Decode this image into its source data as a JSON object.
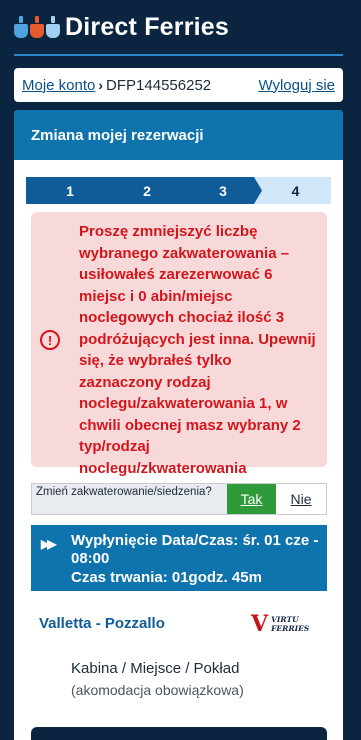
{
  "brand": {
    "name": "Direct Ferries",
    "icons": [
      "ferry-icon-blue",
      "ferry-icon-red",
      "ferry-icon-light-blue"
    ],
    "colors": [
      "#4ea3e0",
      "#e65a2b",
      "#9fd0f2"
    ]
  },
  "account": {
    "my_account": "Moje konto",
    "separator": "›",
    "booking_ref": "DFP144556252",
    "logout": "Wyloguj sie"
  },
  "card": {
    "title": "Zmiana mojej rezerwacji"
  },
  "steps": [
    {
      "label": "1",
      "state": "done"
    },
    {
      "label": "2",
      "state": "done"
    },
    {
      "label": "3",
      "state": "done"
    },
    {
      "label": "4",
      "state": "current"
    }
  ],
  "alert": {
    "icon": "exclamation-circle-icon",
    "symbol": "!",
    "message": "Proszę zmniejszyć liczbę wybranego zakwaterowania – usiłowałeś zarezerwować 6 miejsc i 0 abin/miejsc noclegowych chociaż ilość 3 podróżujących jest inna. Upewnij się, że wybrałeś tylko zaznaczony rodzaj noclegu/zakwaterowania 1, w chwili obecnej masz wybrany 2 typ/rodzaj noclegu/zkwaterowania"
  },
  "change": {
    "question": "Zmień zakwaterowanie/siedzenia?",
    "yes": "Tak",
    "no": "Nie"
  },
  "departure": {
    "icon": "fast-forward-icon",
    "icon_glyph": "▶▶",
    "time_label": "Wypłynięcie Data/Czas:",
    "time_value": "śr. 01 cze - 08:00",
    "duration_label": "Czas trwania:",
    "duration_value": "01godz. 45m"
  },
  "route": {
    "name": "Valletta - Pozzallo",
    "operator_mark": "V",
    "operator_line1": "VIRTU",
    "operator_line2": "FERRIES"
  },
  "accommodation": {
    "title": "Kabina / Miejsce / Pokład",
    "subtitle": "(akomodacja obowiązkowa)"
  },
  "colors": {
    "navy": "#0b2440",
    "primary": "#0f73ad",
    "alert_bg": "#f8d9da",
    "alert_text": "#d4151c",
    "success": "#2e9a3a"
  }
}
